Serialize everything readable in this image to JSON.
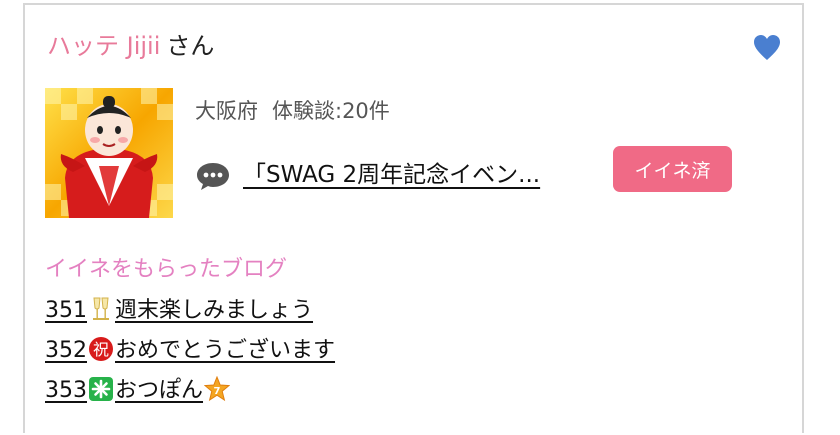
{
  "user": {
    "name": "ハッテ Jijii",
    "honorific": "さん"
  },
  "profile": {
    "location": "大阪府",
    "experience_count": "体験談:20件"
  },
  "latest_post": {
    "title": "「SWAG 2周年記念イベン..."
  },
  "like_button": {
    "label": "イイネ済"
  },
  "liked_blogs": {
    "heading": "イイネをもらったブログ",
    "items": [
      {
        "number": "351",
        "icon": "champagne-icon",
        "title": "週末楽しみましょう"
      },
      {
        "number": "352",
        "icon": "celebration-kanji-icon",
        "title": "おめでとうございます"
      },
      {
        "number": "353",
        "icon": "sparkle-icon",
        "title": "おつぽん",
        "trailing_icon": "star-7-icon"
      }
    ]
  },
  "colors": {
    "name_pink": "#e87a9a",
    "heading_pink": "#e481c1",
    "button_pink": "#f06a86",
    "heart_blue": "#4a7fd0"
  }
}
